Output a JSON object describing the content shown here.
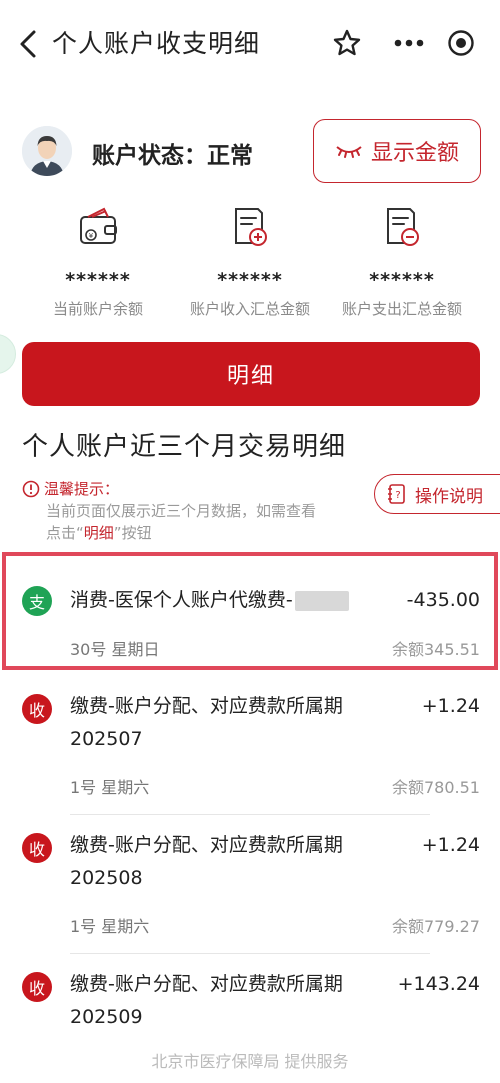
{
  "header": {
    "title": "个人账户收支明细",
    "icons": [
      "back-icon",
      "star-icon",
      "more-icon",
      "target-icon"
    ]
  },
  "account": {
    "status_label": "账户状态：正常",
    "show_amount_label": "显示金额"
  },
  "stats": [
    {
      "value": "******",
      "label": "当前账户余额",
      "icon": "wallet-icon"
    },
    {
      "value": "******",
      "label": "账户收入汇总金额",
      "icon": "doc-plus-icon"
    },
    {
      "value": "******",
      "label": "账户支出汇总金额",
      "icon": "doc-minus-icon"
    }
  ],
  "detail_button_label": "明细",
  "section_title": "个人账户近三个月交易明细",
  "tip": {
    "title": "温馨提示：",
    "body_prefix": "当前页面仅展示近三个月数据，如需查看",
    "body_mid": "点击“",
    "body_link": "明细",
    "body_suffix": "”按钮"
  },
  "op_button_label": "操作说明",
  "transactions": [
    {
      "badge": "支",
      "badge_color": "#1fa355",
      "desc": "消费-医保个人账户代缴费-",
      "amount": "-435.00",
      "date": "30号 星期日",
      "balance": "余额345.51"
    },
    {
      "badge": "收",
      "badge_color": "#c8161d",
      "desc": "缴费-账户分配、对应费款所属期202507",
      "amount": "+1.24",
      "date": "1号 星期六",
      "balance": "余额780.51"
    },
    {
      "badge": "收",
      "badge_color": "#c8161d",
      "desc": "缴费-账户分配、对应费款所属期202508",
      "amount": "+1.24",
      "date": "1号 星期六",
      "balance": "余额779.27"
    },
    {
      "badge": "收",
      "badge_color": "#c8161d",
      "desc": "缴费-账户分配、对应费款所属期202509",
      "amount": "+143.24",
      "date": "",
      "balance": ""
    }
  ],
  "footer": "北京市医疗保障局 提供服务",
  "colors": {
    "accent": "#c8161d",
    "expense": "#1fa355",
    "highlight": "#e0485a"
  }
}
